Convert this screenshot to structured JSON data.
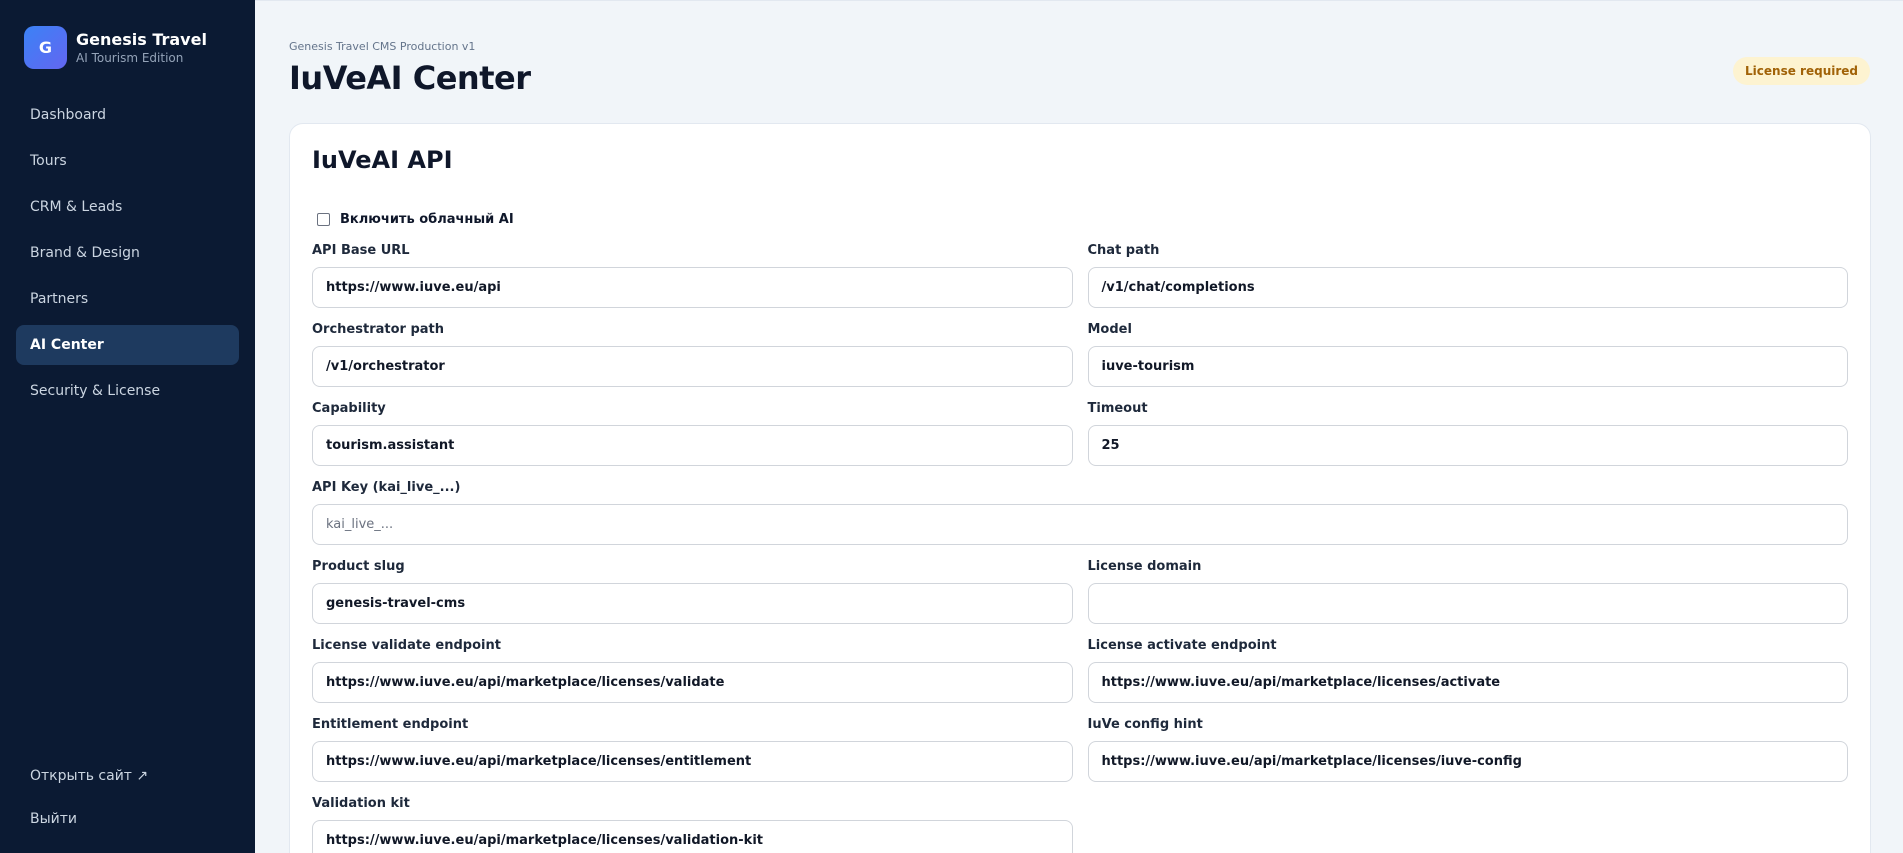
{
  "brand": {
    "logo_letter": "G",
    "name": "Genesis Travel",
    "subtitle": "AI Tourism Edition"
  },
  "nav": {
    "items": [
      {
        "label": "Dashboard"
      },
      {
        "label": "Tours"
      },
      {
        "label": "CRM & Leads"
      },
      {
        "label": "Brand & Design"
      },
      {
        "label": "Partners"
      },
      {
        "label": "AI Center"
      },
      {
        "label": "Security & License"
      }
    ],
    "active": "AI Center"
  },
  "sidebar_bottom": {
    "open_site": "Открыть сайт ↗",
    "logout": "Выйти"
  },
  "header": {
    "breadcrumb": "Genesis Travel CMS Production v1",
    "title": "IuVeAI Center",
    "badge": "License required"
  },
  "card": {
    "title": "IuVeAI API",
    "checkbox_label": "Включить облачный AI",
    "checkbox_checked": false,
    "fields": {
      "api_base_url": {
        "label": "API Base URL",
        "value": "https://www.iuve.eu/api"
      },
      "chat_path": {
        "label": "Chat path",
        "value": "/v1/chat/completions"
      },
      "orchestrator_path": {
        "label": "Orchestrator path",
        "value": "/v1/orchestrator"
      },
      "model": {
        "label": "Model",
        "value": "iuve-tourism"
      },
      "capability": {
        "label": "Capability",
        "value": "tourism.assistant"
      },
      "timeout": {
        "label": "Timeout",
        "value": "25"
      },
      "api_key": {
        "label": "API Key (kai_live_...)",
        "value": "",
        "placeholder": "kai_live_..."
      },
      "product_slug": {
        "label": "Product slug",
        "value": "genesis-travel-cms"
      },
      "license_domain": {
        "label": "License domain",
        "value": ""
      },
      "license_validate": {
        "label": "License validate endpoint",
        "value": "https://www.iuve.eu/api/marketplace/licenses/validate"
      },
      "license_activate": {
        "label": "License activate endpoint",
        "value": "https://www.iuve.eu/api/marketplace/licenses/activate"
      },
      "entitlement": {
        "label": "Entitlement endpoint",
        "value": "https://www.iuve.eu/api/marketplace/licenses/entitlement"
      },
      "config_hint": {
        "label": "IuVe config hint",
        "value": "https://www.iuve.eu/api/marketplace/licenses/iuve-config"
      },
      "validation_kit": {
        "label": "Validation kit",
        "value": "https://www.iuve.eu/api/marketplace/licenses/validation-kit"
      }
    }
  },
  "colors": {
    "sidebar_bg": "#0b1a33",
    "active_nav_bg": "#1e3a5f",
    "badge_bg": "#fdf3d1",
    "badge_text": "#a16207",
    "logo_gradient_start": "#3b82f6",
    "logo_gradient_end": "#6366f1"
  }
}
